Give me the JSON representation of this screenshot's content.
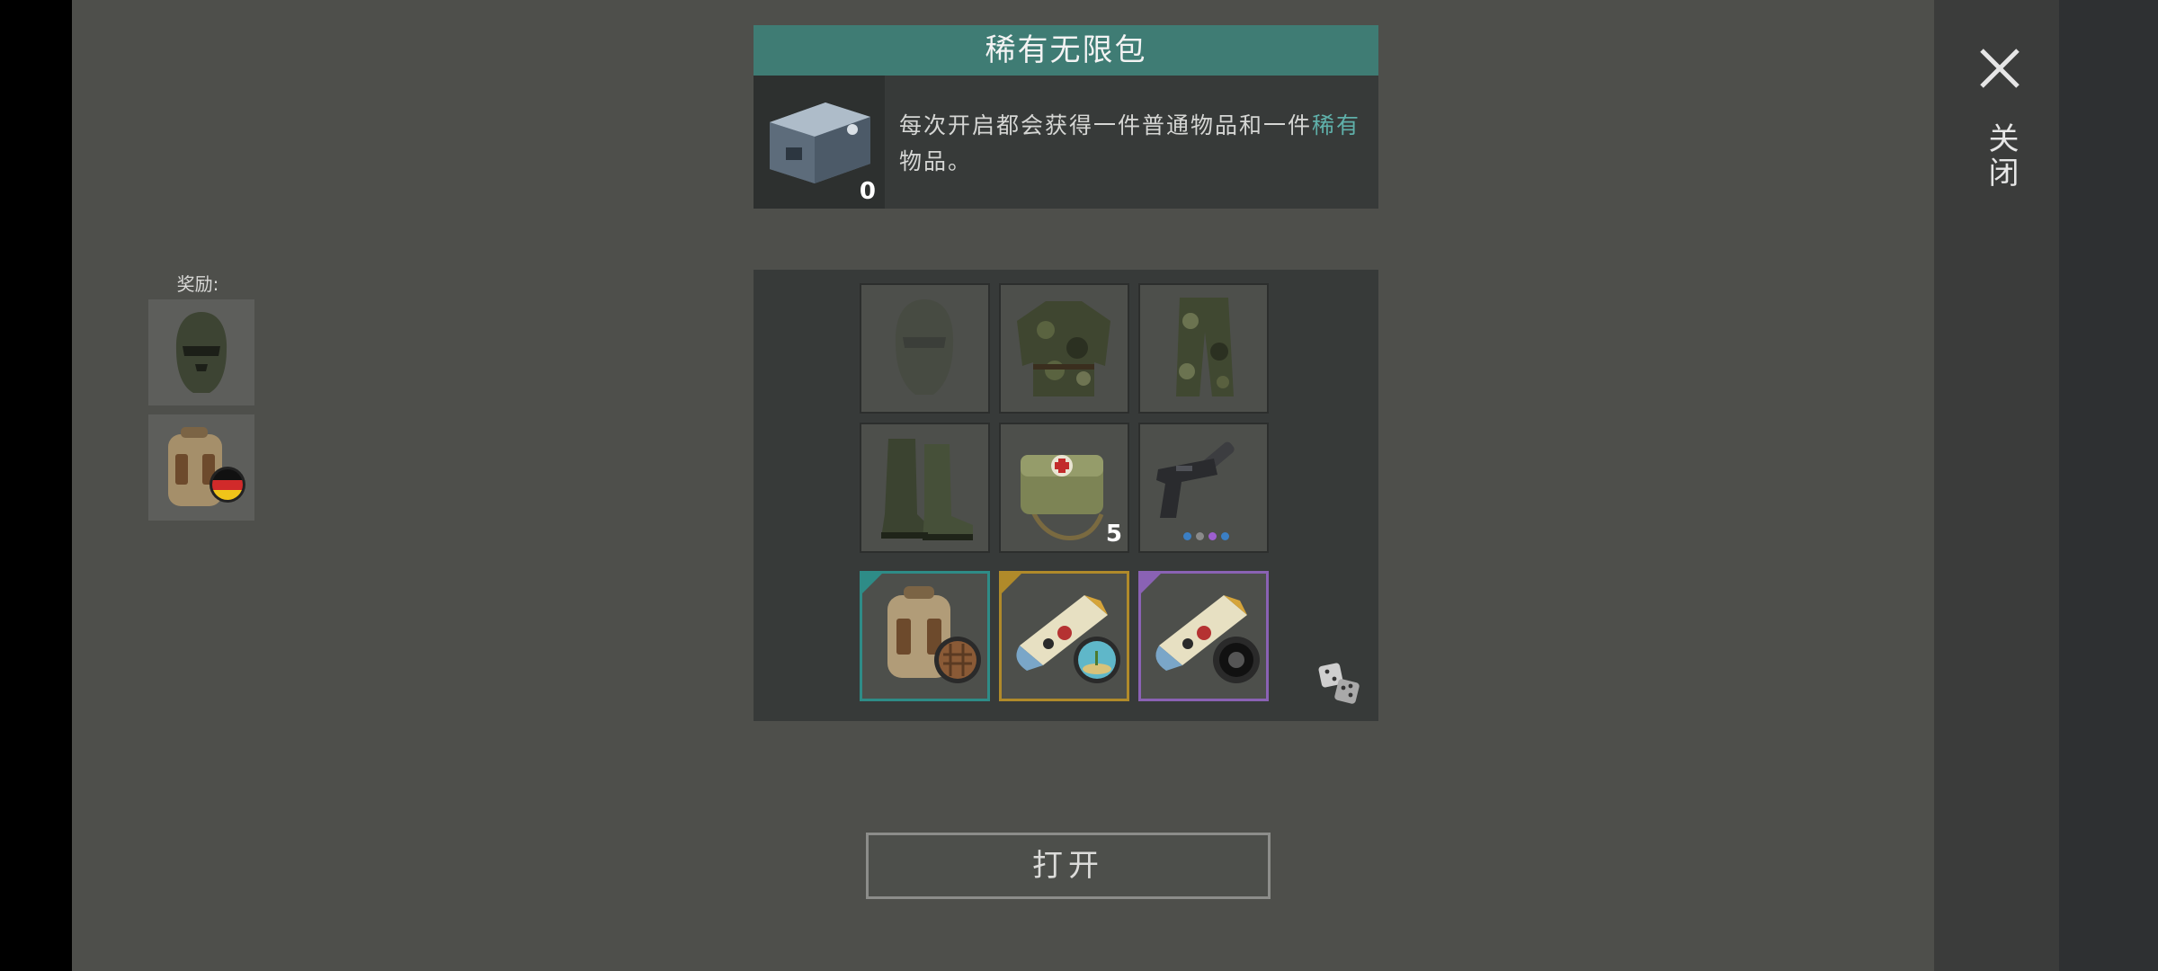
{
  "pack": {
    "title": "稀有无限包",
    "count": "0",
    "description_part1": "每次开启都会获得一件普通物品和一件",
    "description_rare": "稀有",
    "description_part2": "物品。",
    "icon": "metal-crate-icon"
  },
  "rewards": {
    "label": "奖励:",
    "items": [
      {
        "icon": "balaclava-icon"
      },
      {
        "icon": "backpack-germany-flag-icon"
      }
    ]
  },
  "grid": {
    "items": [
      {
        "icon": "balaclava-icon",
        "faded": true
      },
      {
        "icon": "camo-jacket-icon"
      },
      {
        "icon": "camo-pants-icon"
      },
      {
        "icon": "combat-boots-icon"
      },
      {
        "icon": "medical-bag-icon",
        "count": "5"
      },
      {
        "icon": "silenced-pistol-icon",
        "dots": [
          "#3b7fc4",
          "#8a8a8a",
          "#9d5fd0",
          "#3b7fc4"
        ]
      },
      {
        "icon": "backpack-wicker-badge-icon",
        "rarity": "teal"
      },
      {
        "icon": "blueprint-scroll-island-icon",
        "rarity": "gold"
      },
      {
        "icon": "blueprint-scroll-wheel-icon",
        "rarity": "purple"
      }
    ]
  },
  "actions": {
    "open_label": "打开",
    "close_label": "关闭",
    "randomize_icon": "dice-icon"
  },
  "colors": {
    "header_teal": "#3f7c74",
    "rare_text": "#5fb0aa",
    "rarity_teal": "#2e8c87",
    "rarity_gold": "#b08a2a",
    "rarity_purple": "#8a62b4"
  }
}
